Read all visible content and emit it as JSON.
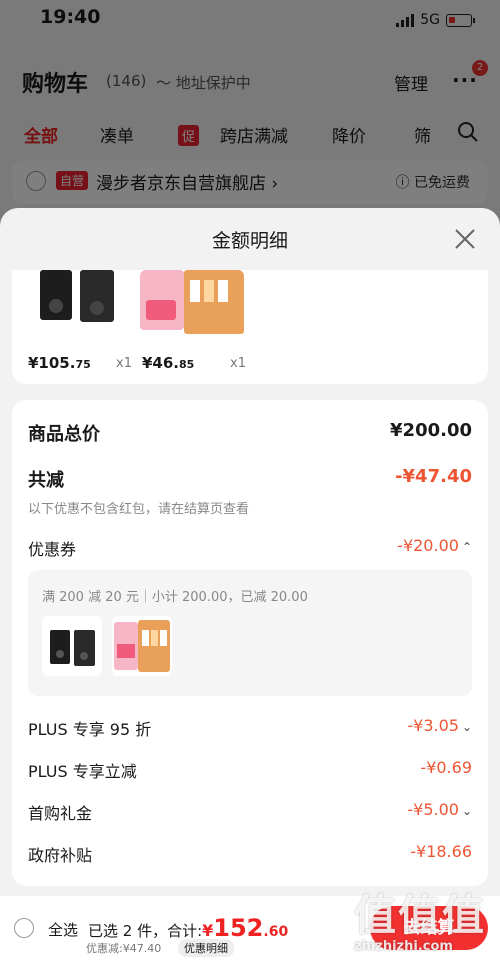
{
  "status_bar": {
    "time": "19:40",
    "network": "5G"
  },
  "cart": {
    "title": "购物车",
    "count": "(146)",
    "address_protect": "地址保护中",
    "manage": "管理",
    "more_badge": "2",
    "tabs": [
      "全部",
      "凑单",
      "促",
      "跨店满减",
      "降价",
      "筛"
    ],
    "store": {
      "tag": "自营",
      "name": "漫步者京东自营旗舰店 ›",
      "shipping": "ⓘ 已免运费"
    }
  },
  "sheet": {
    "title": "金额明细",
    "products": [
      {
        "price_int": "¥105.",
        "price_dec": "75",
        "qty": "x1"
      },
      {
        "price_int": "¥46.",
        "price_dec": "85",
        "qty": "x1"
      }
    ],
    "total_label": "商品总价",
    "total_value": "¥200.00",
    "reduce_label": "共减",
    "reduce_value": "-¥47.40",
    "note": "以下优惠不包含红包，请在结算页查看",
    "coupon_label": "优惠券",
    "coupon_value": "-¥20.00",
    "coupon_desc": "满 200 减 20 元｜小计 200.00，已减 20.00",
    "discounts": [
      {
        "label": "PLUS 专享 95 折",
        "value": "-¥3.05",
        "chevron": true
      },
      {
        "label": "PLUS 专享立减",
        "value": "-¥0.69",
        "chevron": false
      },
      {
        "label": "首购礼金",
        "value": "-¥5.00",
        "chevron": true
      },
      {
        "label": "政府补贴",
        "value": "-¥18.66",
        "chevron": false
      }
    ]
  },
  "bottom_bar": {
    "select_all": "全选",
    "selected_text": "已选 2 件，合计:",
    "total_symbol": "¥",
    "total_int": "152",
    "total_dec": ".60",
    "discount_line": "优惠减:¥47.40",
    "detail_pill": "优惠明细",
    "checkout": "去结算"
  },
  "watermark": {
    "big": "值值值",
    "small": "zhizhizhi.com"
  },
  "colors": {
    "accent_red": "#f23030",
    "discount_red": "#ee5533"
  }
}
